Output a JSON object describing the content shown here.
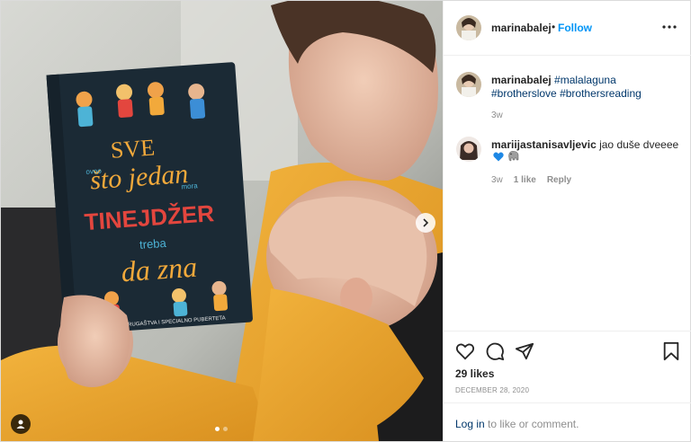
{
  "post": {
    "username": "marinabalej",
    "separator": "•",
    "follow_label": "Follow",
    "more_icon": "more-options-icon"
  },
  "caption": {
    "username": "marinabalej",
    "hashtags": [
      "#malalaguna",
      "#brotherslove",
      "#brothersreading"
    ],
    "time": "3w"
  },
  "comment": {
    "username": "mariijastanisavljevic",
    "text": "jao duše dveeee",
    "emojis": [
      "blue-heart-icon",
      "elephant-icon"
    ],
    "time": "3w",
    "likes": "1 like",
    "reply_label": "Reply"
  },
  "book": {
    "title_line1": "SVE",
    "title_line2": "što jedan",
    "title_line3": "TINEJDŽER",
    "title_line4": "treba",
    "title_line5": "da zna",
    "small_1": "ovoo",
    "small_2": "mora",
    "subtitle": "O OSTALOG DRUGAŠTVA I SPECIALNO PUBERTETA"
  },
  "stats": {
    "likes": "29 likes",
    "date": "DECEMBER 28, 2020"
  },
  "login": {
    "link": "Log in",
    "rest": "to like or comment."
  },
  "carousel": {
    "count": 2,
    "active": 0
  },
  "colors": {
    "link_blue": "#0095f6",
    "hashtag": "#00376b",
    "muted": "#8e8e8e"
  }
}
